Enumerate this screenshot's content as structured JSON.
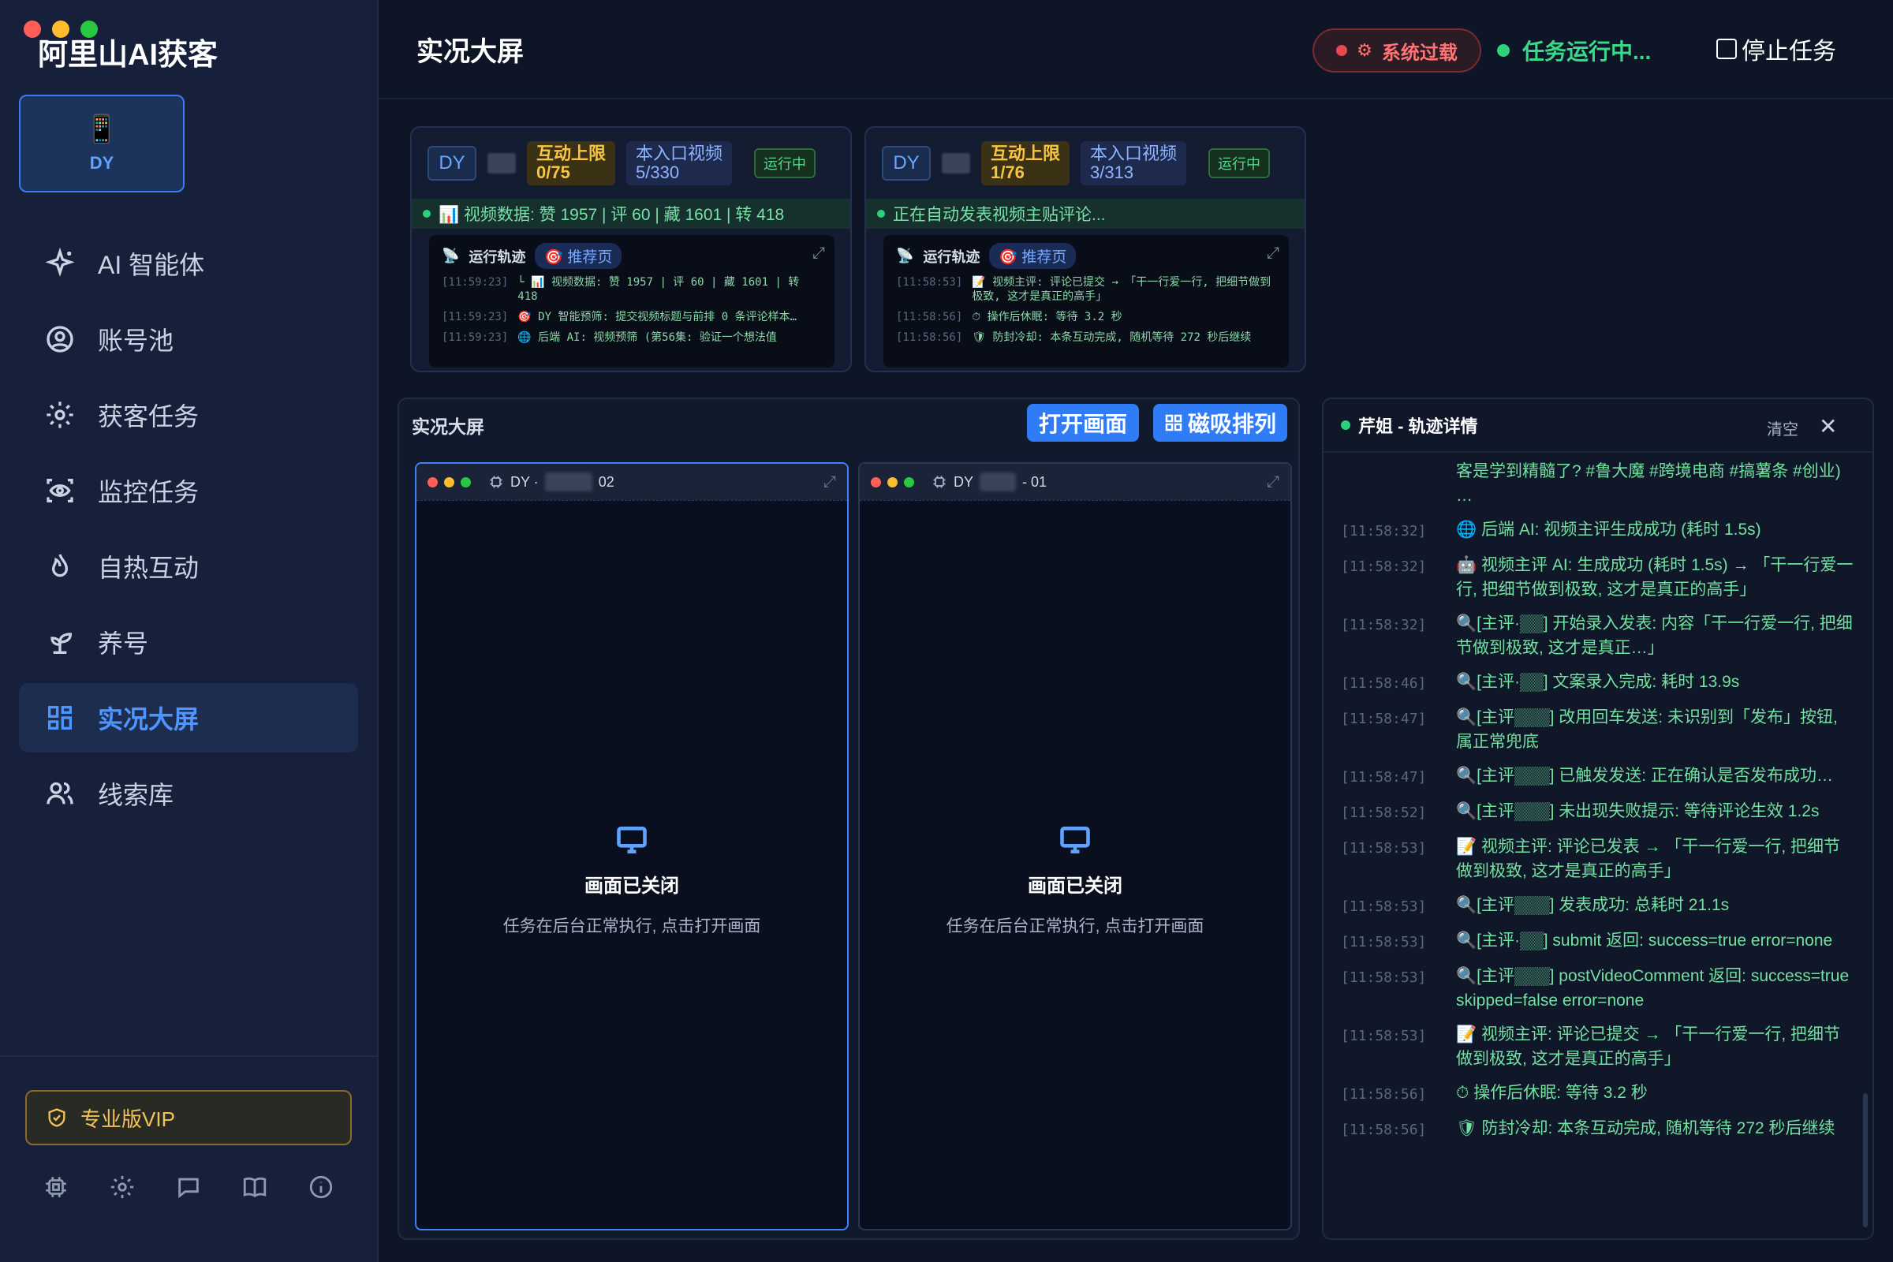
{
  "app": {
    "title": "阿里山AI获客"
  },
  "account": {
    "icon": "📱",
    "label": "DY"
  },
  "nav": [
    {
      "label": "AI 智能体",
      "icon": "sparkle-icon"
    },
    {
      "label": "账号池",
      "icon": "user-circle-icon"
    },
    {
      "label": "获客任务",
      "icon": "gear-icon"
    },
    {
      "label": "监控任务",
      "icon": "eye-scan-icon"
    },
    {
      "label": "自热互动",
      "icon": "flame-icon"
    },
    {
      "label": "养号",
      "icon": "sprout-icon"
    },
    {
      "label": "实况大屏",
      "icon": "grid-icon",
      "active": true
    },
    {
      "label": "线索库",
      "icon": "users-icon"
    }
  ],
  "vip": {
    "label": "专业版VIP"
  },
  "header": {
    "title": "实况大屏",
    "overload": "系统过载",
    "running": "任务运行中...",
    "stop": "停止任务"
  },
  "tasks": [
    {
      "platform": "DY",
      "limit_label": "互动上限",
      "limit_value": "0/75",
      "video_label": "本入口视频",
      "video_value": "5/330",
      "state": "运行中",
      "status": "📊 视频数据: 赞 1957 | 评 60 | 藏 1601 | 转 418",
      "log_title": "运行轨迹",
      "page_tag": "🎯 推荐页",
      "logs": [
        {
          "ts": "[11:59:23]",
          "text": "└ 📊 视频数据: 赞 1957 | 评 60 | 藏 1601 | 转 418"
        },
        {
          "ts": "[11:59:23]",
          "text": "🎯 DY 智能预筛: 提交视频标题与前排 0 条评论样本…"
        },
        {
          "ts": "[11:59:23]",
          "text": "🌐 后端 AI: 视频预筛 (第56集: 验证一个想法值"
        }
      ]
    },
    {
      "platform": "DY",
      "limit_label": "互动上限",
      "limit_value": "1/76",
      "video_label": "本入口视频",
      "video_value": "3/313",
      "state": "运行中",
      "status": "正在自动发表视频主贴评论...",
      "log_title": "运行轨迹",
      "page_tag": "🎯 推荐页",
      "logs": [
        {
          "ts": "[11:58:53]",
          "text": "📝 视频主评: 评论已提交 → 「干一行爱一行, 把细节做到极致, 这才是真正的高手」"
        },
        {
          "ts": "[11:58:56]",
          "text": "⏱ 操作后休眠: 等待 3.2 秒"
        },
        {
          "ts": "[11:58:56]",
          "text": "🛡 防封冷却: 本条互动完成, 随机等待 272 秒后继续"
        }
      ]
    }
  ],
  "live": {
    "title": "实况大屏",
    "open_label": "打开画面",
    "snap_label": "磁吸排列",
    "screens": [
      {
        "platform": "DY ·",
        "suffix": "02",
        "closed_title": "画面已关闭",
        "closed_hint": "任务在后台正常执行, 点击打开画面"
      },
      {
        "platform": "DY",
        "suffix": "- 01",
        "closed_title": "画面已关闭",
        "closed_hint": "任务在后台正常执行, 点击打开画面"
      }
    ]
  },
  "detail": {
    "title": "芹姐 - 轨迹详情",
    "clear": "清空",
    "first": "客是学到精髓了? #鲁大魔 #跨境电商 #搞薯条 #创业) …",
    "lines": [
      {
        "ts": "[11:58:32]",
        "text": "🌐 后端 AI: 视频主评生成成功 (耗时 1.5s)"
      },
      {
        "ts": "[11:58:32]",
        "text": "🤖 视频主评 AI: 生成成功 (耗时 1.5s) → 「干一行爱一行, 把细节做到极致, 这才是真正的高手」"
      },
      {
        "ts": "[11:58:32]",
        "text": "🔍[主评·▒▒] 开始录入发表: 内容「干一行爱一行, 把细节做到极致, 这才是真正…」"
      },
      {
        "ts": "[11:58:46]",
        "text": "🔍[主评·▒▒] 文案录入完成: 耗时 13.9s"
      },
      {
        "ts": "[11:58:47]",
        "text": "🔍[主评▒▒▒] 改用回车发送: 未识别到「发布」按钮, 属正常兜底"
      },
      {
        "ts": "[11:58:47]",
        "text": "🔍[主评▒▒▒] 已触发发送: 正在确认是否发布成功…"
      },
      {
        "ts": "[11:58:52]",
        "text": "🔍[主评▒▒▒] 未出现失败提示: 等待评论生效 1.2s"
      },
      {
        "ts": "[11:58:53]",
        "text": "📝 视频主评: 评论已发表 → 「干一行爱一行, 把细节做到极致, 这才是真正的高手」"
      },
      {
        "ts": "[11:58:53]",
        "text": "🔍[主评▒▒▒] 发表成功: 总耗时 21.1s"
      },
      {
        "ts": "[11:58:53]",
        "text": "🔍[主评·▒▒] submit 返回: success=true error=none"
      },
      {
        "ts": "[11:58:53]",
        "text": "🔍[主评▒▒▒] postVideoComment 返回: success=true skipped=false error=none"
      },
      {
        "ts": "[11:58:53]",
        "text": "📝 视频主评: 评论已提交 → 「干一行爱一行, 把细节做到极致, 这才是真正的高手」"
      },
      {
        "ts": "[11:58:56]",
        "text": "⏱ 操作后休眠: 等待 3.2 秒"
      },
      {
        "ts": "[11:58:56]",
        "text": "🛡 防封冷却: 本条互动完成, 随机等待 272 秒后继续"
      }
    ]
  },
  "colors": {
    "accent": "#2f7cf6",
    "success": "#2fd07a",
    "danger": "#e5484d",
    "warning": "#f8c543"
  }
}
